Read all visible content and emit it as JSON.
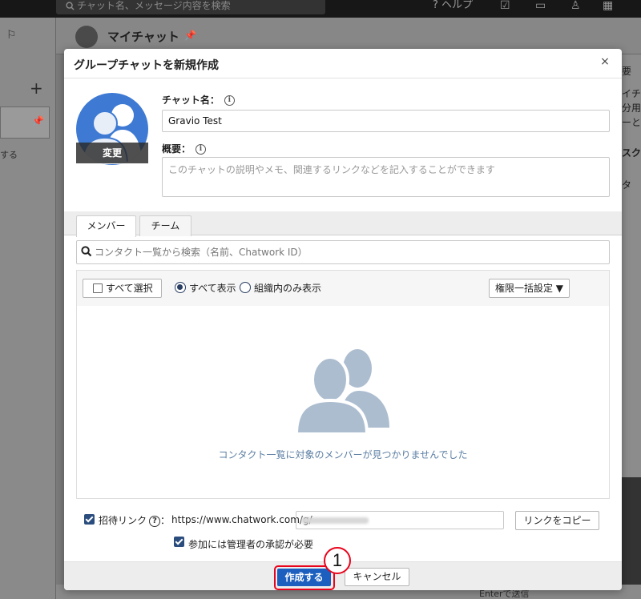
{
  "background": {
    "search_placeholder": "チャット名、メッセージ内容を検索",
    "help_label": "ヘルプ",
    "chat_title": "マイチャット",
    "left_side_text": "する",
    "right_texts": [
      "要",
      "イチャ",
      "分用の",
      "ーとし",
      "スク",
      "タ"
    ],
    "bottom_text": "Enterで送信"
  },
  "modal": {
    "title": "グループチャットを新規作成",
    "close_label": "×",
    "avatar_change_label": "変更",
    "name_label": "チャット名：",
    "name_value": "Gravio Test",
    "desc_label": "概要：",
    "desc_placeholder": "このチャットの説明やメモ、関連するリンクなどを記入することができます",
    "tabs": [
      {
        "label": "メンバー",
        "active": true
      },
      {
        "label": "チーム",
        "active": false
      }
    ],
    "search_placeholder": "コンタクト一覧から検索（名前、Chatwork ID）",
    "select_all_label": "すべて選択",
    "radio_all_label": "すべて表示",
    "radio_org_label": "組織内のみ表示",
    "permission_button_label": "権限一括設定 ▼",
    "empty_message": "コンタクト一覧に対象のメンバーが見つかりませんでした",
    "invite_label": "招待リンク",
    "invite_colon": "：",
    "invite_url_prefix": "https://www.chatwork.com/g/",
    "copy_button_label": "リンクをコピー",
    "approval_label": "参加には管理者の承認が必要",
    "create_button_label": "作成する",
    "cancel_button_label": "キャンセル"
  },
  "annotation": {
    "step_number": "1"
  },
  "colors": {
    "primary_button": "#1c5fbf",
    "highlight_red": "#e8041c",
    "avatar_blue": "#3e7ad3",
    "empty_text": "#5d7fa4"
  }
}
